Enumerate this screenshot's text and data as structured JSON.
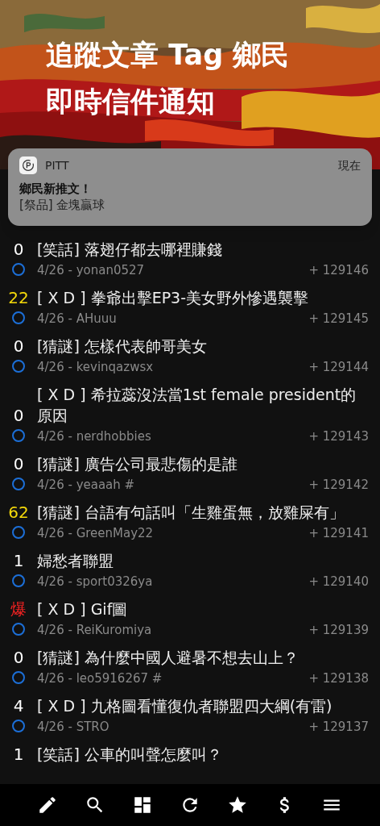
{
  "banner": {
    "title_lines": [
      "追蹤文章 Tag 鄉民",
      "即時信件通知"
    ]
  },
  "notification": {
    "app": "PITT",
    "time": "現在",
    "title": "鄉民新推文！",
    "body": "[祭品] 金塊贏球"
  },
  "posts": [
    {
      "score": "0",
      "color": "#ffffff",
      "title": "[笑話] 落翅仔都去哪裡賺錢",
      "meta": "4/26 - yonan0527",
      "number": "+ 129146"
    },
    {
      "score": "22",
      "color": "#f5d90a",
      "title": "[ X D ] 拳爺出擊EP3-美女野外慘遇襲擊",
      "meta": "4/26 - AHuuu",
      "number": "+ 129145"
    },
    {
      "score": "0",
      "color": "#ffffff",
      "title": "[猜謎] 怎樣代表帥哥美女",
      "meta": "4/26 - kevinqazwsx",
      "number": "+ 129144"
    },
    {
      "score": "0",
      "color": "#ffffff",
      "title": "[ X D ] 希拉蕊沒法當1st female president的原因",
      "meta": "4/26 - nerdhobbies",
      "number": "+ 129143"
    },
    {
      "score": "0",
      "color": "#ffffff",
      "title": "[猜謎] 廣告公司最悲傷的是誰",
      "meta": "4/26 - yeaaah #",
      "number": "+ 129142"
    },
    {
      "score": "62",
      "color": "#f5d90a",
      "title": "[猜謎] 台語有句話叫「生雞蛋無，放雞屎有」",
      "meta": "4/26 - GreenMay22",
      "number": "+ 129141"
    },
    {
      "score": "1",
      "color": "#ffffff",
      "title": "婦愁者聯盟",
      "meta": "4/26 - sport0326ya",
      "number": "+ 129140"
    },
    {
      "score": "爆",
      "color": "#ee2222",
      "title": "[ X D ] Gif圖",
      "meta": "4/26 - ReiKuromiya",
      "number": "+ 129139"
    },
    {
      "score": "0",
      "color": "#ffffff",
      "title": "[猜謎] 為什麼中國人避暑不想去山上？",
      "meta": "4/26 - leo5916267 #",
      "number": "+ 129138"
    },
    {
      "score": "4",
      "color": "#ffffff",
      "title": "[ X D ] 九格圖看懂復仇者聯盟四大綱(有雷)",
      "meta": "4/26 - STRO",
      "number": "+ 129137"
    },
    {
      "score": "1",
      "color": "#ffffff",
      "title": "[笑話] 公車的叫聲怎麼叫？"
    }
  ],
  "tabbar": [
    {
      "kind": "edit"
    },
    {
      "kind": "search"
    },
    {
      "kind": "dashboard"
    },
    {
      "kind": "refresh"
    },
    {
      "kind": "star"
    },
    {
      "kind": "dollar"
    },
    {
      "kind": "menu"
    }
  ]
}
